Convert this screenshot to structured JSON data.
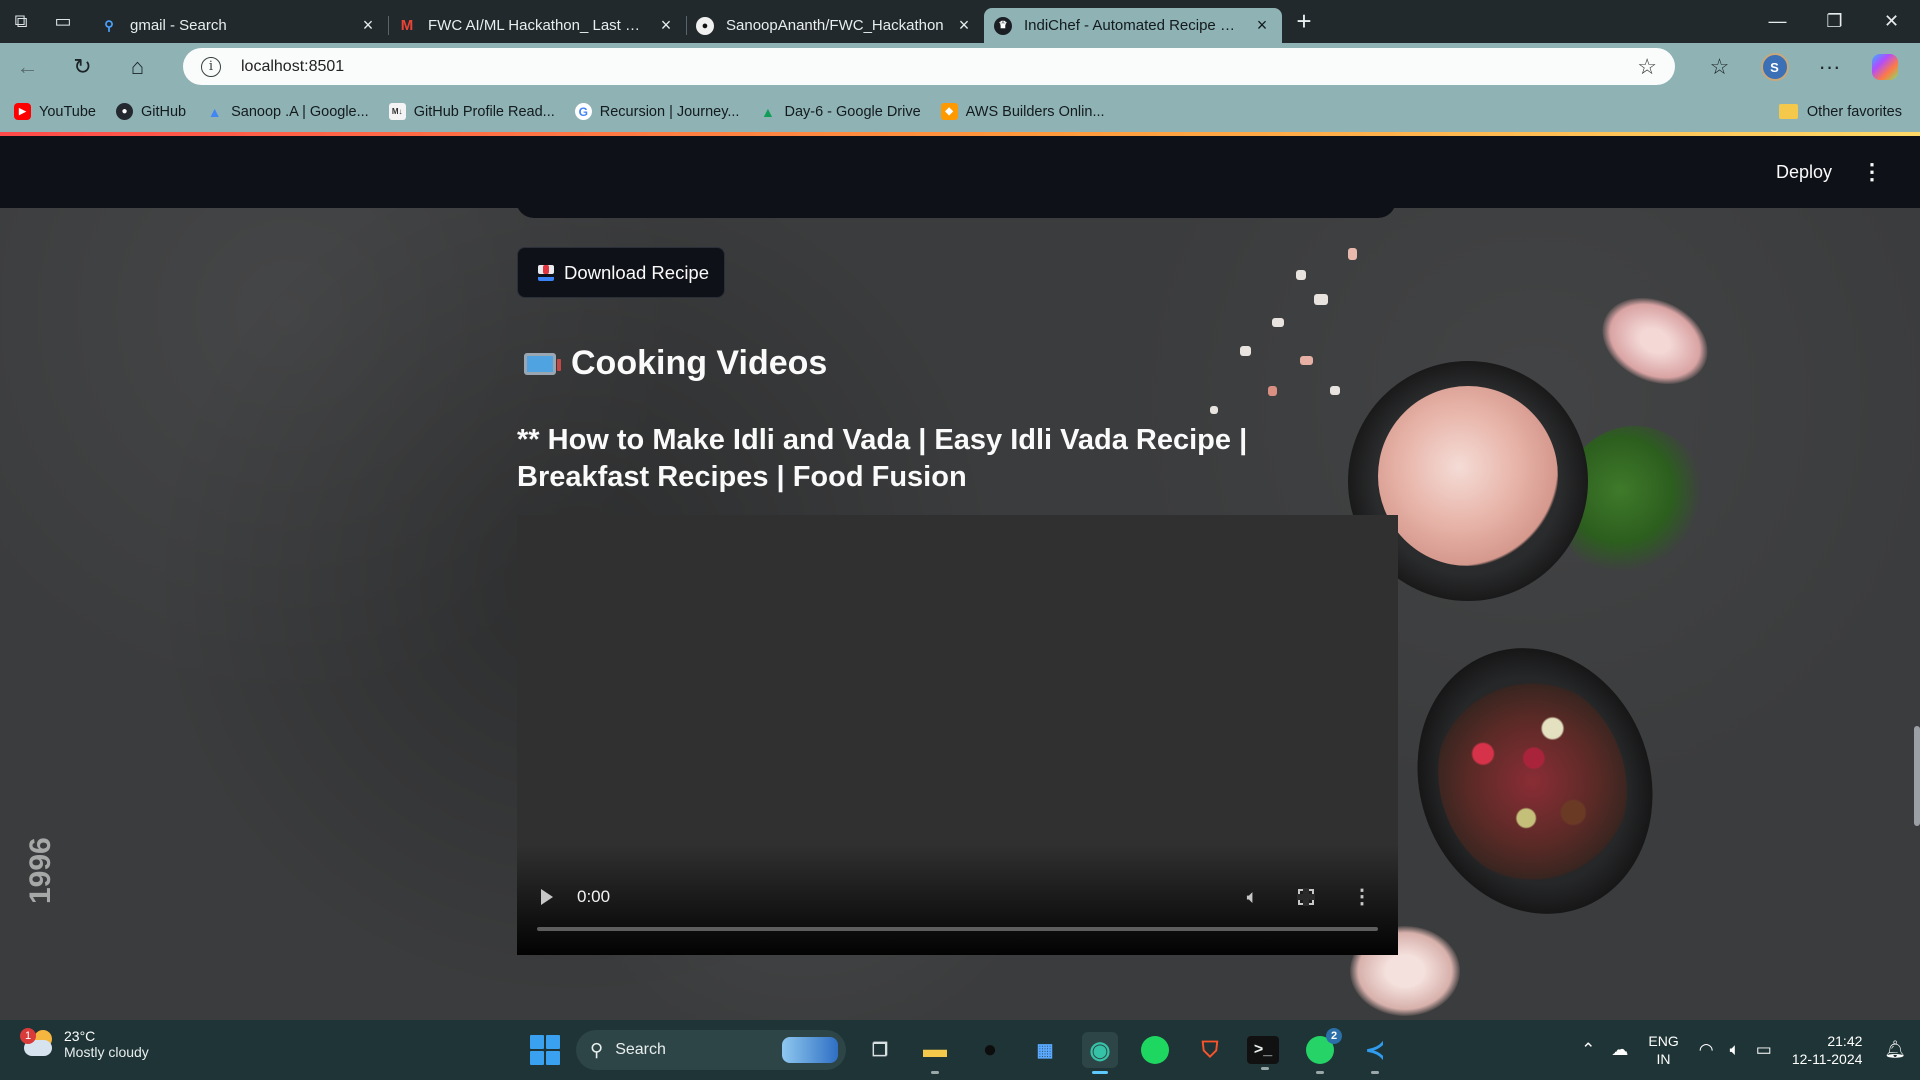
{
  "browser": {
    "tabs": [
      {
        "title": "gmail - Search",
        "icon": "search-icon",
        "active": false
      },
      {
        "title": "FWC AI/ML Hackathon_ Last date",
        "icon": "gmail-icon",
        "active": false
      },
      {
        "title": "SanoopAnanth/FWC_Hackathon",
        "icon": "github-icon",
        "active": false
      },
      {
        "title": "IndiChef - Automated Recipe Gen",
        "icon": "streamlit-icon",
        "active": true
      }
    ],
    "url": "localhost:8501",
    "bookmarks": [
      {
        "label": "YouTube",
        "icon": "youtube-icon",
        "color": "#ff0000"
      },
      {
        "label": "GitHub",
        "icon": "github-icon",
        "color": "#24292f"
      },
      {
        "label": "Sanoop .A | Google...",
        "icon": "google-drive-icon",
        "color": "#4285f4"
      },
      {
        "label": "GitHub Profile Read...",
        "icon": "readme-icon",
        "color": "#e8e8e8"
      },
      {
        "label": "Recursion | Journey...",
        "icon": "google-icon",
        "color": "#ffffff"
      },
      {
        "label": "Day-6 - Google Drive",
        "icon": "google-drive-icon",
        "color": "#0f9d58"
      },
      {
        "label": "AWS Builders Onlin...",
        "icon": "aws-icon",
        "color": "#ff9900"
      }
    ],
    "other_favorites": "Other favorites",
    "avatar_initial": "S"
  },
  "app": {
    "deploy_label": "Deploy",
    "download_button": "Download Recipe",
    "section_heading": "Cooking Videos",
    "video_title": "** How to Make Idli and Vada | Easy Idli Vada Recipe | Breakfast Recipes | Food Fusion",
    "video_time": "0:00",
    "watermark": "1996"
  },
  "taskbar": {
    "weather_temp": "23°C",
    "weather_desc": "Mostly cloudy",
    "weather_badge": "1",
    "search_label": "Search",
    "whatsapp_badge": "2",
    "lang_top": "ENG",
    "lang_bottom": "IN",
    "time": "21:42",
    "date": "12-11-2024"
  }
}
